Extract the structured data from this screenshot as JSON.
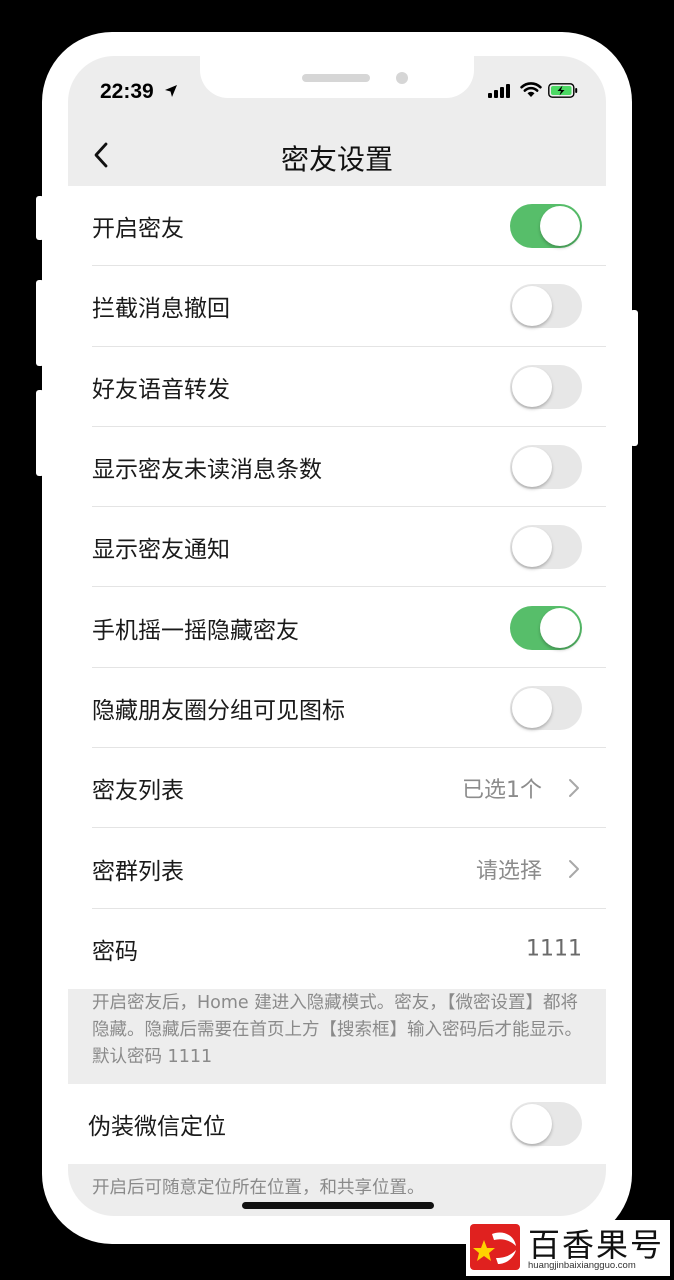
{
  "status_bar": {
    "time": "22:39"
  },
  "nav": {
    "title": "密友设置"
  },
  "settings": [
    {
      "label": "开启密友",
      "toggle": true
    },
    {
      "label": "拦截消息撤回",
      "toggle": false
    },
    {
      "label": "好友语音转发",
      "toggle": false
    },
    {
      "label": "显示密友未读消息条数",
      "toggle": false
    },
    {
      "label": "显示密友通知",
      "toggle": false
    },
    {
      "label": "手机摇一摇隐藏密友",
      "toggle": true
    },
    {
      "label": "隐藏朋友圈分组可见图标",
      "toggle": false
    },
    {
      "label": "密友列表",
      "value": "已选1个"
    },
    {
      "label": "密群列表",
      "value": "请选择"
    },
    {
      "label": "密码",
      "value": "1111"
    }
  ],
  "footer_note": "开启密友后，Home 建进入隐藏模式。密友，【微密设置】都将隐藏。隐藏后需要在首页上方【搜索框】输入密码后才能显示。默认密码 1111",
  "location": {
    "label": "伪装微信定位",
    "toggle": false,
    "note": "开启后可随意定位所在位置，和共享位置。"
  },
  "watermark": {
    "title": "百香果号",
    "url": "huangjinbaixiangguo.com"
  },
  "colors": {
    "toggle_on": "#57be6a",
    "toggle_off": "#e7e7e7",
    "background": "#ededed"
  }
}
